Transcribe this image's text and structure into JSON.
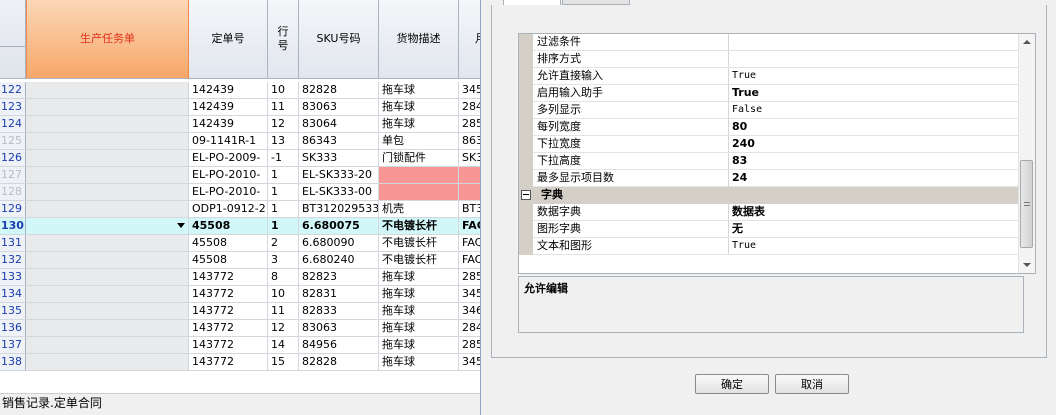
{
  "grid": {
    "headers": {
      "task": "生产任务单",
      "order": "定单号",
      "line": "行号",
      "sku": "SKU号码",
      "desc": "货物描述",
      "more": "月"
    },
    "rows": [
      {
        "rn": "122",
        "order": "142439",
        "line": "10",
        "sku": "82828",
        "desc": "拖车球",
        "more": "345"
      },
      {
        "rn": "123",
        "order": "142439",
        "line": "11",
        "sku": "83063",
        "desc": "拖车球",
        "more": "284"
      },
      {
        "rn": "124",
        "order": "142439",
        "line": "12",
        "sku": "83064",
        "desc": "拖车球",
        "more": "285"
      },
      {
        "rn": "125",
        "order": "09-1141R-1",
        "line": "13",
        "sku": "86343",
        "desc": "单包",
        "more": "863"
      },
      {
        "rn": "126",
        "order": "EL-PO-2009-",
        "line": "-1",
        "sku": "SK333",
        "desc": "门锁配件",
        "more": "SK3"
      },
      {
        "rn": "127",
        "order": "EL-PO-2010-",
        "line": "1",
        "sku": "EL-SK333-20",
        "desc": "",
        "more": ""
      },
      {
        "rn": "128",
        "order": "EL-PO-2010-",
        "line": "1",
        "sku": "EL-SK333-00",
        "desc": "",
        "more": ""
      },
      {
        "rn": "129",
        "order": "ODP1-0912-2",
        "line": "1",
        "sku": "BT312029533",
        "desc": "机壳",
        "more": "BT3"
      },
      {
        "rn": "130",
        "order": "45508",
        "line": "1",
        "sku": "6.680075",
        "desc": "不电镀长杆",
        "more": "FAC"
      },
      {
        "rn": "131",
        "order": "45508",
        "line": "2",
        "sku": "6.680090",
        "desc": "不电镀长杆",
        "more": "FAC"
      },
      {
        "rn": "132",
        "order": "45508",
        "line": "3",
        "sku": "6.680240",
        "desc": "不电镀长杆",
        "more": "FAC"
      },
      {
        "rn": "133",
        "order": "143772",
        "line": "8",
        "sku": "82823",
        "desc": "拖车球",
        "more": "285"
      },
      {
        "rn": "134",
        "order": "143772",
        "line": "10",
        "sku": "82831",
        "desc": "拖车球",
        "more": "345"
      },
      {
        "rn": "135",
        "order": "143772",
        "line": "11",
        "sku": "82833",
        "desc": "拖车球",
        "more": "346"
      },
      {
        "rn": "136",
        "order": "143772",
        "line": "12",
        "sku": "83063",
        "desc": "拖车球",
        "more": "284"
      },
      {
        "rn": "137",
        "order": "143772",
        "line": "14",
        "sku": "84956",
        "desc": "拖车球",
        "more": "285"
      },
      {
        "rn": "138",
        "order": "143772",
        "line": "15",
        "sku": "82828",
        "desc": "拖车球",
        "more": "345"
      }
    ],
    "status": "销售记录.定单合同"
  },
  "props": {
    "rows": [
      {
        "name": "过滤条件",
        "value": "",
        "bold": false
      },
      {
        "name": "排序方式",
        "value": "",
        "bold": false
      },
      {
        "name": "允许直接输入",
        "value": "True",
        "bold": false
      },
      {
        "name": "启用输入助手",
        "value": "True",
        "bold": true
      },
      {
        "name": "多列显示",
        "value": "False",
        "bold": false
      },
      {
        "name": "每列宽度",
        "value": "80",
        "bold": true
      },
      {
        "name": "下拉宽度",
        "value": "240",
        "bold": true
      },
      {
        "name": "下拉高度",
        "value": "83",
        "bold": true
      },
      {
        "name": "最多显示项目数",
        "value": "24",
        "bold": true
      }
    ],
    "category": "字典",
    "dict_rows": [
      {
        "name": "数据字典",
        "value": "数据表",
        "bold": true
      },
      {
        "name": "图形字典",
        "value": "无",
        "bold": true
      },
      {
        "name": "文本和图形",
        "value": "True",
        "bold": false
      }
    ],
    "description": "允许编辑"
  },
  "buttons": {
    "ok": "确定",
    "cancel": "取消"
  }
}
